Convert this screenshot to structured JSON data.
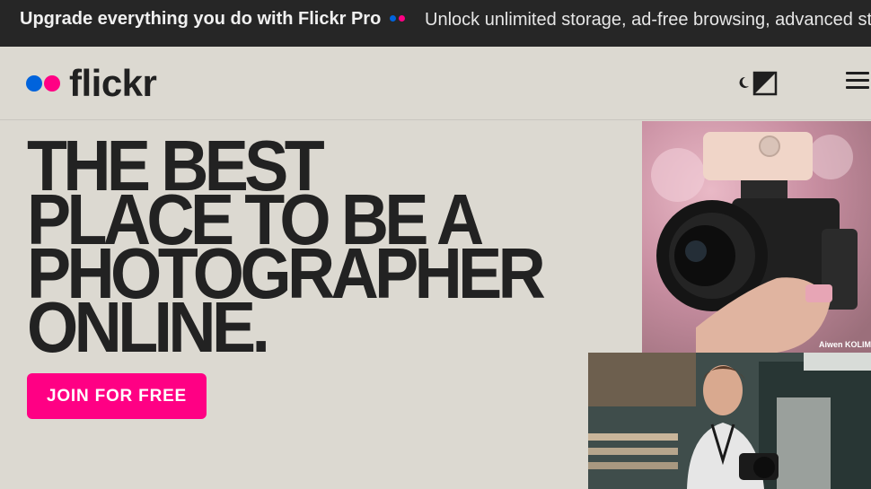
{
  "promo": {
    "title": "Upgrade everything you do with Flickr Pro",
    "text": "Unlock unlimited storage, ad-free browsing, advanced st",
    "dot_colors": [
      "#0063dc",
      "#ff0084"
    ]
  },
  "header": {
    "logo_text": "flickr",
    "logo_dot_colors": [
      "#0063dc",
      "#ff0084"
    ],
    "theme_toggle_icon": "theme-toggle-icon",
    "menu_icon": "hamburger-menu-icon"
  },
  "hero": {
    "lines": [
      "THE BEST",
      "PLACE TO BE A",
      "PHOTOGRAPHER",
      "ONLINE."
    ],
    "cta_label": "JOIN FOR FREE",
    "cta_color": "#ff0084"
  },
  "photos": {
    "photo1_credit": "Aiwen KOLIM"
  }
}
